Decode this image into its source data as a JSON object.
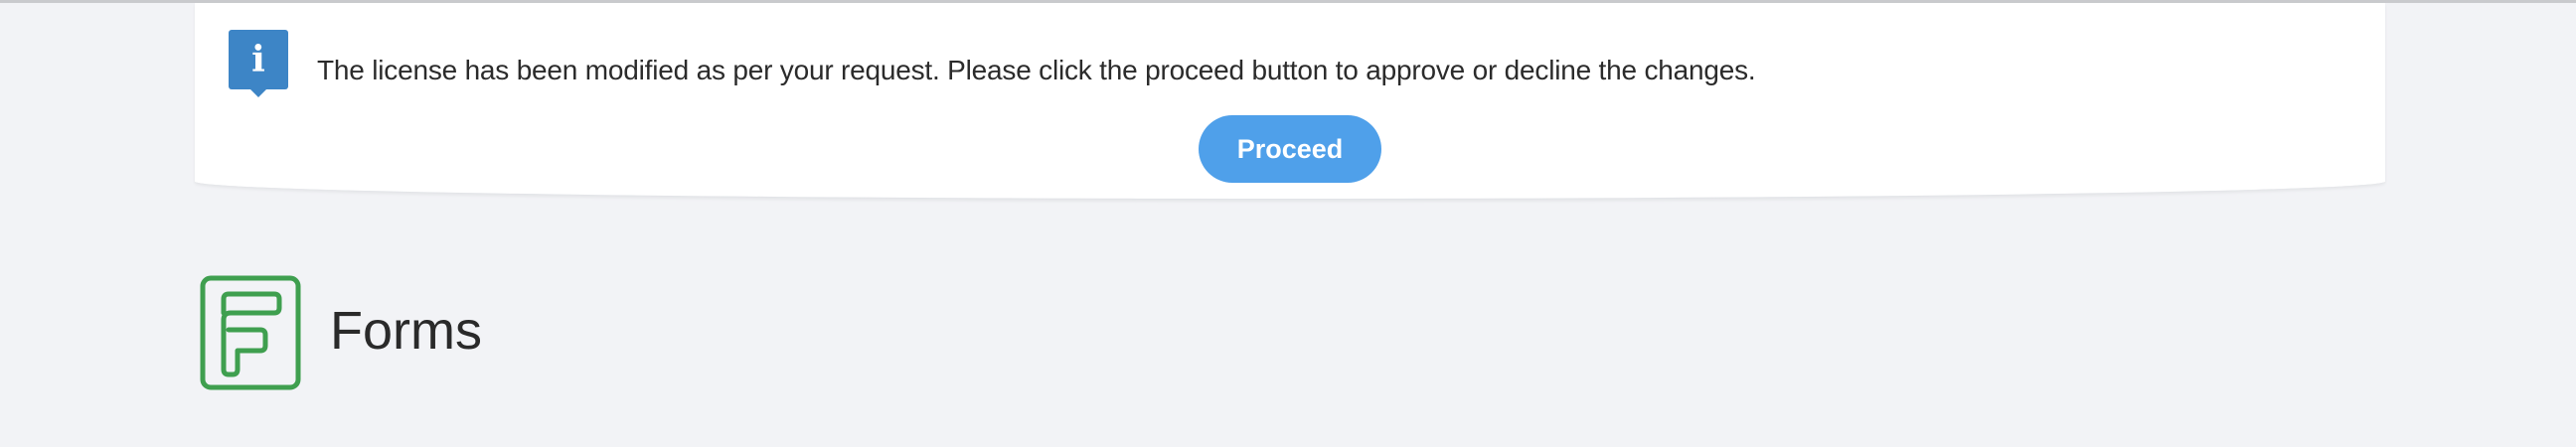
{
  "notice": {
    "icon": "info-icon",
    "icon_glyph": "i",
    "message": "The license has been modified as per your request. Please click the proceed button to approve or decline the changes.",
    "proceed_label": "Proceed",
    "icon_color": "#3d85c6",
    "button_color": "#4fa0ea"
  },
  "app": {
    "logo_icon": "forms-logo-icon",
    "title": "Forms",
    "brand_color": "#3f9f4f"
  },
  "colors": {
    "page_background": "#f2f3f6",
    "card_background": "#ffffff"
  }
}
